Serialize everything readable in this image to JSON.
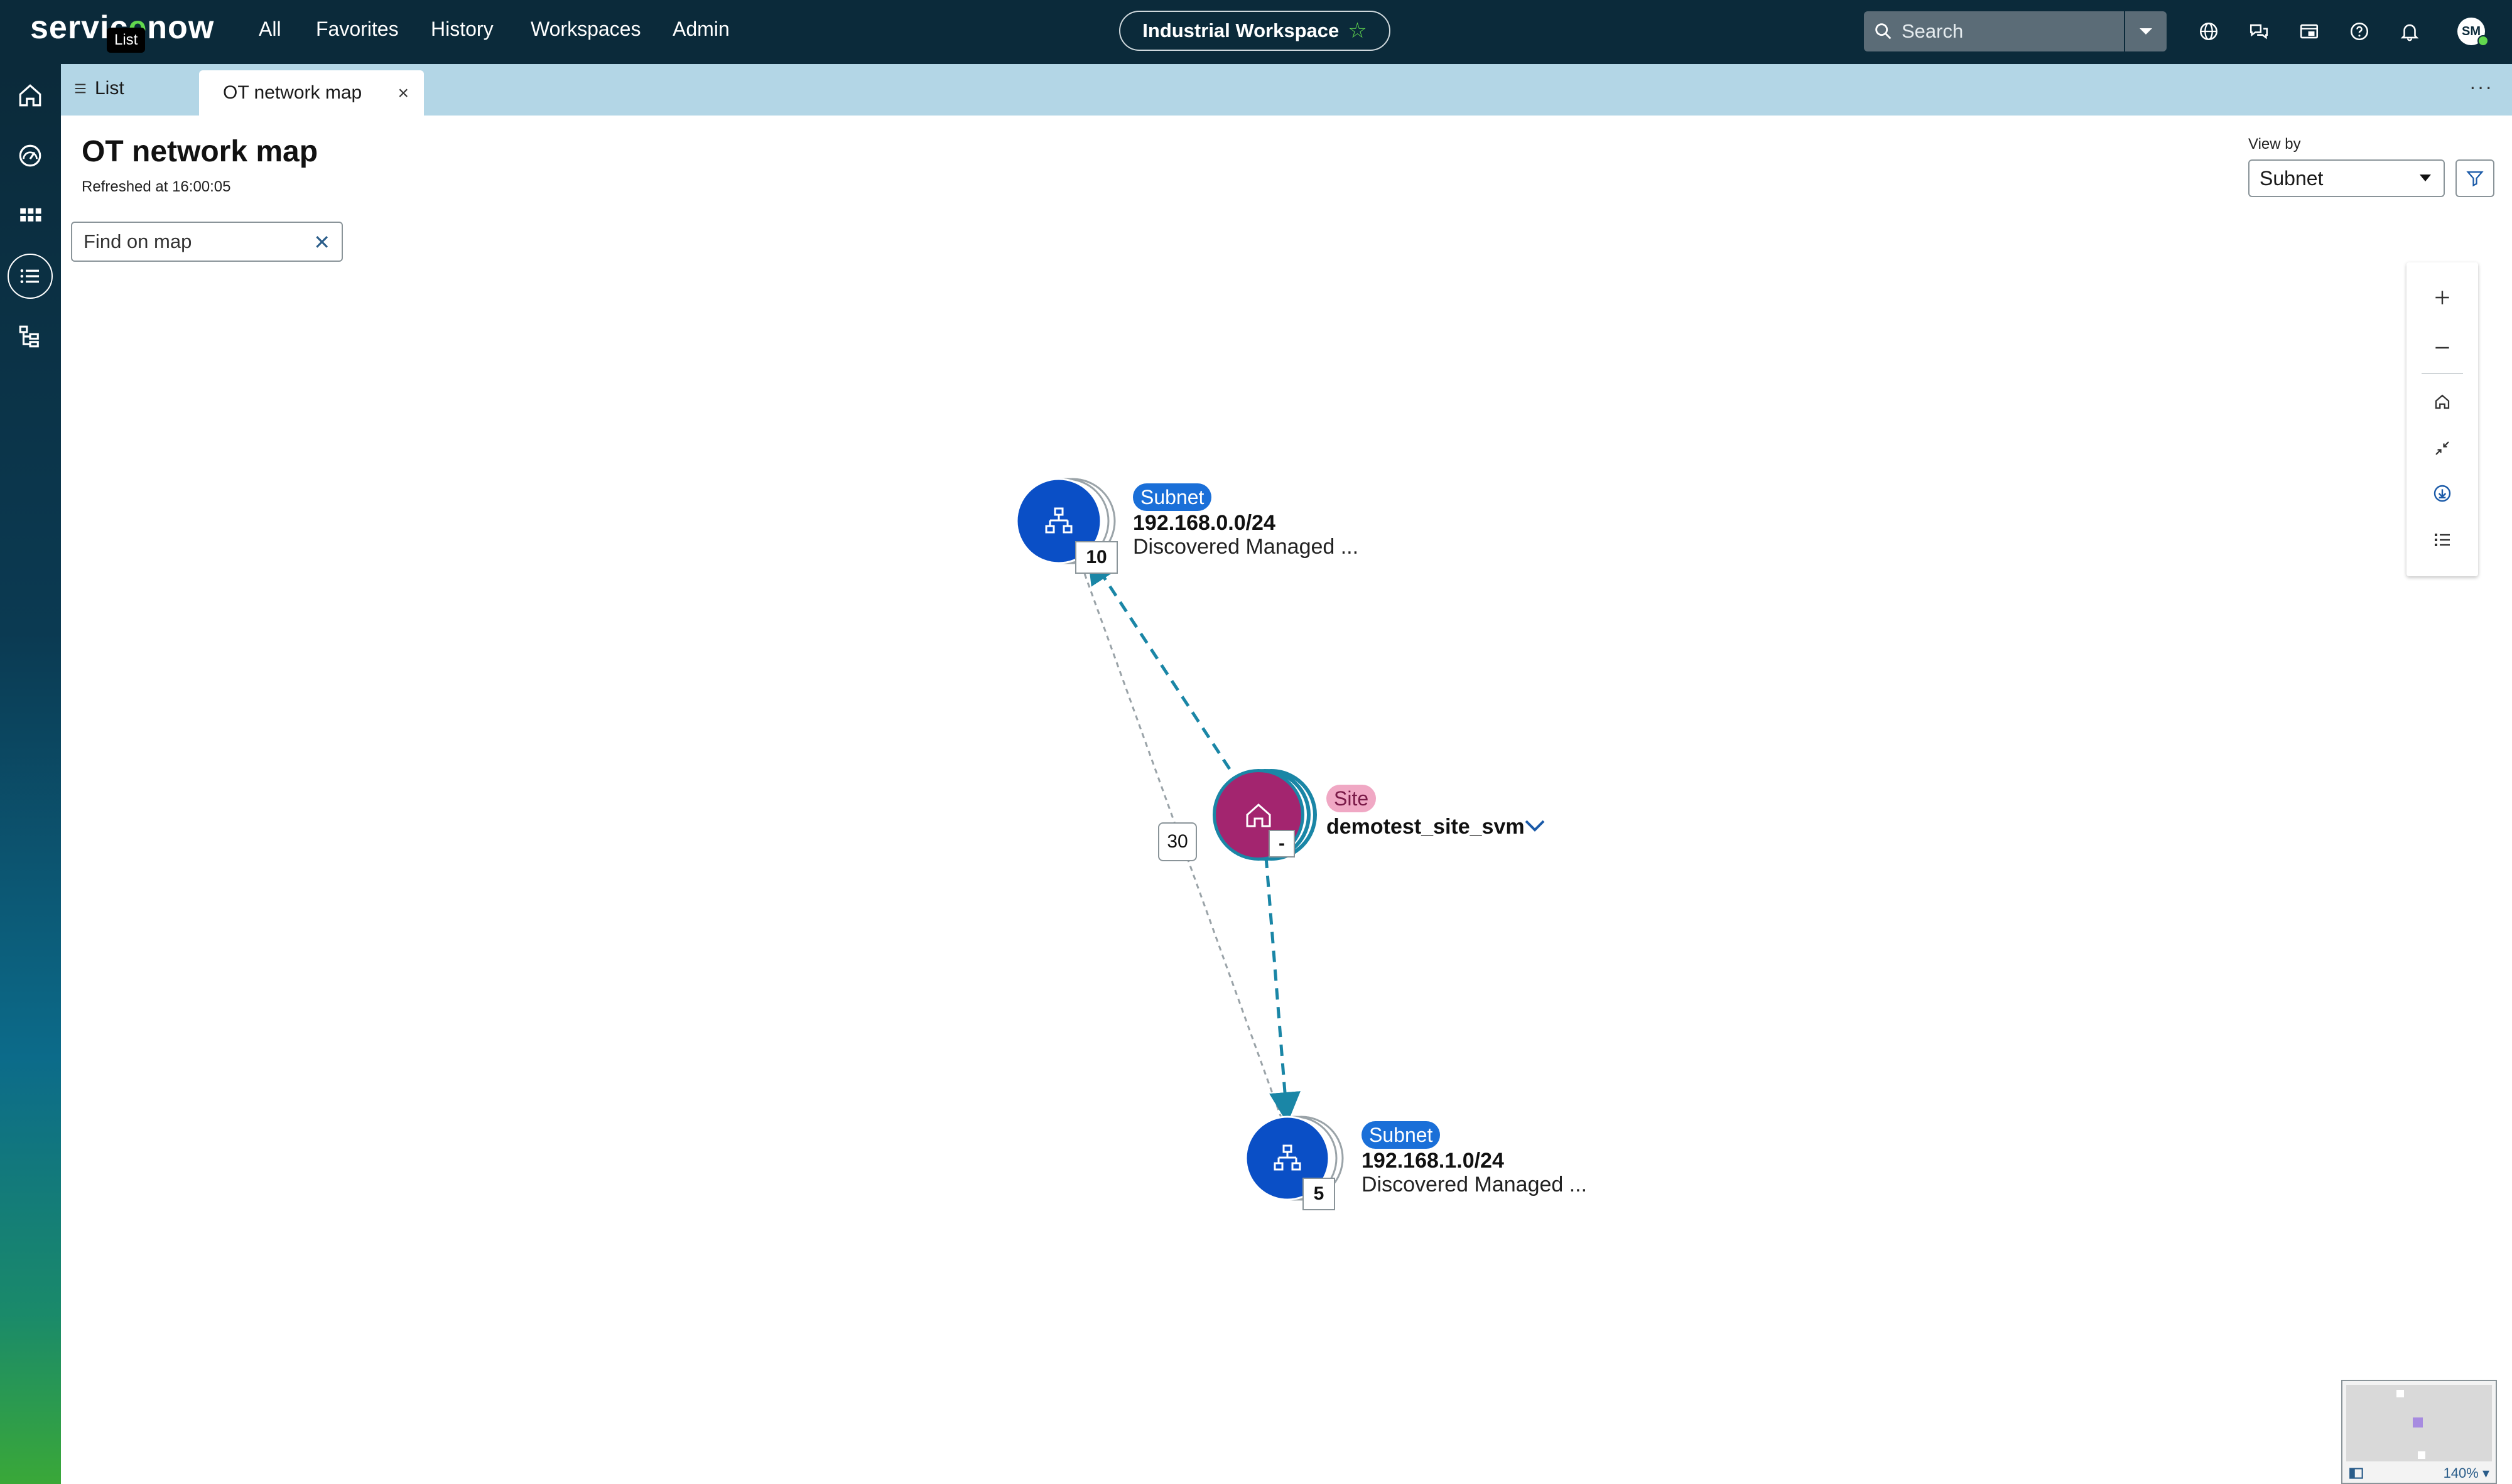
{
  "topbar": {
    "logo_prefix": "servic",
    "logo_o": "e",
    "logo_suffix": "now",
    "tooltip": "List",
    "nav": {
      "all": "All",
      "favorites": "Favorites",
      "history": "History",
      "workspaces": "Workspaces",
      "admin": "Admin"
    },
    "workspace": "Industrial Workspace",
    "search_placeholder": "Search",
    "avatar": "SM"
  },
  "tabs": {
    "list": "List",
    "active": "OT network map"
  },
  "page": {
    "title": "OT network map",
    "refreshed": "Refreshed at 16:00:05"
  },
  "find": {
    "placeholder": "Find on map"
  },
  "viewby": {
    "label": "View by",
    "value": "Subnet"
  },
  "map": {
    "nodes": [
      {
        "type": "Subnet",
        "ip": "192.168.0.0/24",
        "desc": "Discovered Managed ...",
        "count": "10"
      },
      {
        "type": "Site",
        "name": "demotest_site_svm",
        "count": "-"
      },
      {
        "type": "Subnet",
        "ip": "192.168.1.0/24",
        "desc": "Discovered Managed ...",
        "count": "5"
      }
    ],
    "edge_count": "30"
  },
  "minimap": {
    "zoom": "140% ▾"
  },
  "colors": {
    "subnet": "#0a4fc6",
    "site": "#a3256f",
    "edge": "#1a86a6",
    "accent": "#62d84e"
  }
}
